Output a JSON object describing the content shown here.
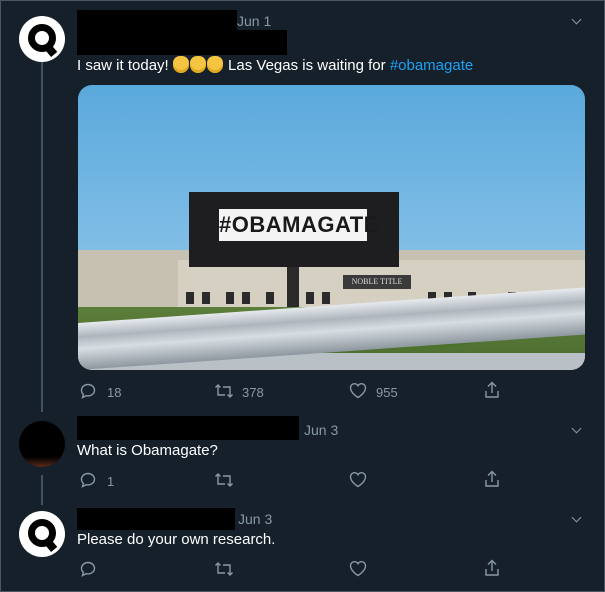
{
  "tweets": [
    {
      "date": "Jun 1",
      "text_before": "I saw it today! ",
      "text_middle": " Las Vegas is waiting for ",
      "hashtag": "#obamagate",
      "media": {
        "billboard_text": "#OBAMAGATE",
        "building_sign": "NOBLE TITLE"
      },
      "reply_count": "18",
      "retweet_count": "378",
      "like_count": "955"
    },
    {
      "date": "Jun 3",
      "text": "What is Obamagate?",
      "reply_count": "1"
    },
    {
      "date": "Jun 3",
      "text": "Please do your own research."
    }
  ],
  "colors": {
    "background": "#15202b",
    "muted": "#8899a6",
    "link": "#1da1f2",
    "thread_line": "#3d5466"
  },
  "icons": {
    "reply": "reply-icon",
    "retweet": "retweet-icon",
    "like": "heart-icon",
    "share": "share-icon",
    "more": "chevron-down-icon"
  }
}
